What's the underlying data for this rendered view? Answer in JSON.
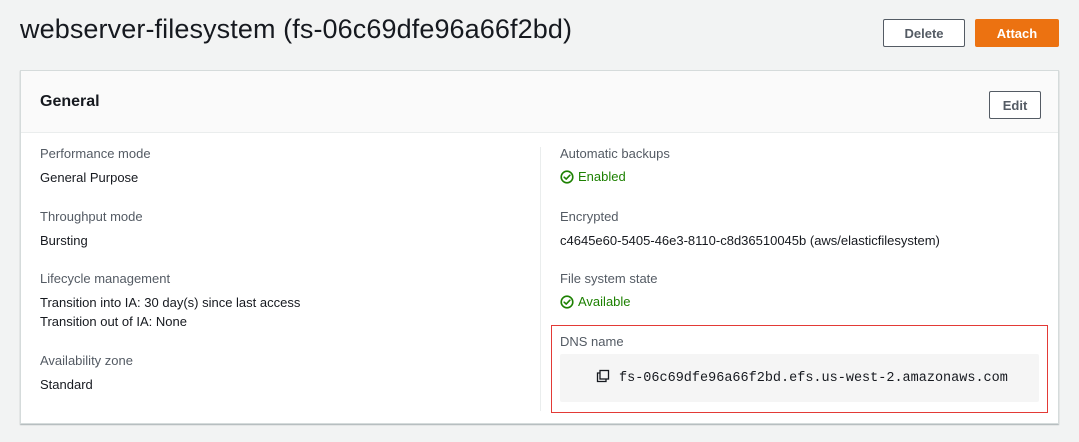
{
  "header": {
    "title": "webserver-filesystem (fs-06c69dfe96a66f2bd)",
    "delete_label": "Delete",
    "attach_label": "Attach"
  },
  "panel": {
    "title": "General",
    "edit_label": "Edit"
  },
  "left_fields": {
    "performance_mode": {
      "label": "Performance mode",
      "value": "General Purpose"
    },
    "throughput_mode": {
      "label": "Throughput mode",
      "value": "Bursting"
    },
    "lifecycle": {
      "label": "Lifecycle management",
      "line1": "Transition into IA: 30 day(s) since last access",
      "line2": "Transition out of IA: None"
    },
    "availability_zone": {
      "label": "Availability zone",
      "value": "Standard"
    }
  },
  "right_fields": {
    "automatic_backups": {
      "label": "Automatic backups",
      "value": "Enabled"
    },
    "encrypted": {
      "label": "Encrypted",
      "value": "c4645e60-5405-46e3-8110-c8d36510045b (aws/elasticfilesystem)"
    },
    "file_system_state": {
      "label": "File system state",
      "value": "Available"
    },
    "dns_name": {
      "label": "DNS name",
      "value": "fs-06c69dfe96a66f2bd.efs.us-west-2.amazonaws.com"
    }
  },
  "icons": {
    "status": "check-circle-icon",
    "copy": "copy-icon"
  },
  "colors": {
    "primary": "#ec7211",
    "success": "#1d8102",
    "highlight": "#e33a36"
  }
}
